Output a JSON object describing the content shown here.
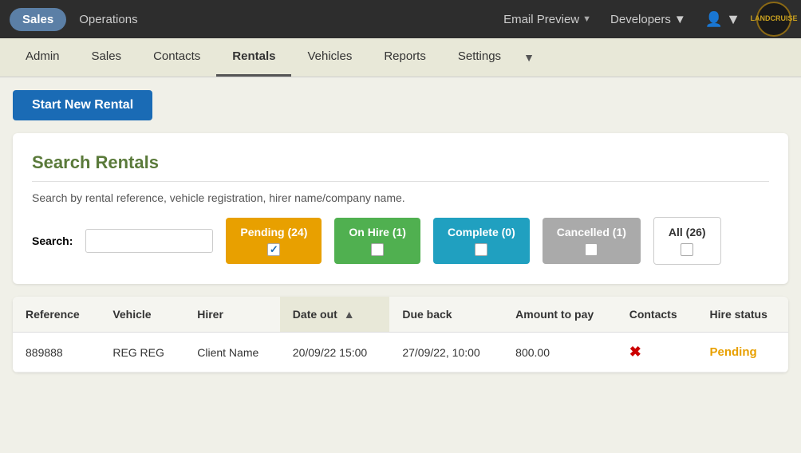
{
  "topNav": {
    "sales_label": "Sales",
    "operations_label": "Operations",
    "email_preview_label": "Email Preview",
    "developers_label": "Developers",
    "logo_line1": "LAND",
    "logo_line2": "CRUISE"
  },
  "secNav": {
    "items": [
      {
        "label": "Admin",
        "active": false
      },
      {
        "label": "Sales",
        "active": false
      },
      {
        "label": "Contacts",
        "active": false
      },
      {
        "label": "Rentals",
        "active": true
      },
      {
        "label": "Vehicles",
        "active": false
      },
      {
        "label": "Reports",
        "active": false
      },
      {
        "label": "Settings",
        "active": false
      }
    ]
  },
  "page": {
    "start_rental_label": "Start New Rental",
    "search_card_title": "Search Rentals",
    "search_desc": "Search by rental reference, vehicle registration, hirer name/company name.",
    "search_label": "Search:",
    "search_placeholder": ""
  },
  "filters": [
    {
      "label": "Pending (24)",
      "color": "pending",
      "checked": true
    },
    {
      "label": "On Hire (1)",
      "color": "onhire",
      "checked": false
    },
    {
      "label": "Complete (0)",
      "color": "complete",
      "checked": false
    },
    {
      "label": "Cancelled (1)",
      "color": "cancelled",
      "checked": false
    },
    {
      "label": "All (26)",
      "color": "all",
      "checked": false
    }
  ],
  "table": {
    "columns": [
      {
        "label": "Reference",
        "sortable": false
      },
      {
        "label": "Vehicle",
        "sortable": false
      },
      {
        "label": "Hirer",
        "sortable": false
      },
      {
        "label": "Date out",
        "sortable": true,
        "sort_dir": "asc"
      },
      {
        "label": "Due back",
        "sortable": false
      },
      {
        "label": "Amount to pay",
        "sortable": false
      },
      {
        "label": "Contacts",
        "sortable": false
      },
      {
        "label": "Hire status",
        "sortable": false
      }
    ],
    "rows": [
      {
        "reference": "889888",
        "vehicle": "REG REG",
        "hirer": "Client Name",
        "date_out": "20/09/22 15:00",
        "due_back": "27/09/22, 10:00",
        "amount_to_pay": "800.00",
        "contacts_status": "x",
        "hire_status": "Pending",
        "hire_status_color": "pending"
      }
    ]
  }
}
